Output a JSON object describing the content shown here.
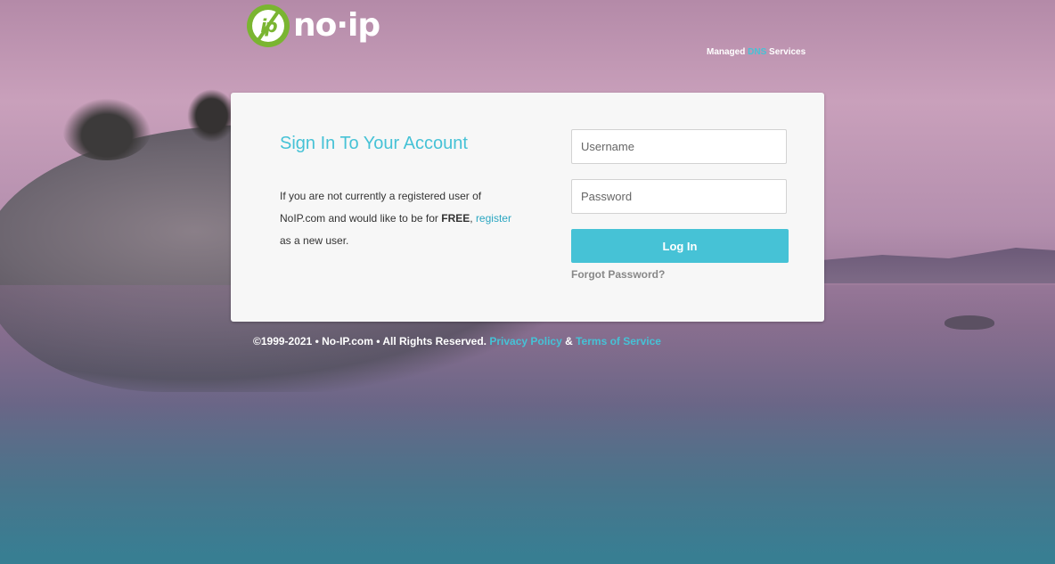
{
  "brand": {
    "logo_mark_text": "ip",
    "logo_text": "no·ip",
    "tagline_before": "Managed",
    "tagline_highlight": "DNS",
    "tagline_after": "Services"
  },
  "login": {
    "title": "Sign In To Your Account",
    "desc_part1": "If you are not currently a registered user of NoIP.com and would like to be for",
    "desc_bold": "FREE",
    "desc_comma": ",",
    "register_link": "register",
    "desc_part2": "as a new user.",
    "username_placeholder": "Username",
    "password_placeholder": "Password",
    "login_button": "Log In",
    "forgot_link": "Forgot Password?"
  },
  "footer": {
    "copyright": "©1999-2021 • No-IP.com • All Rights Reserved.",
    "privacy_link": "Privacy Policy",
    "ampersand": "&",
    "terms_link": "Terms of Service"
  },
  "colors": {
    "accent": "#46c2d6",
    "logo_green": "#7ab531"
  }
}
